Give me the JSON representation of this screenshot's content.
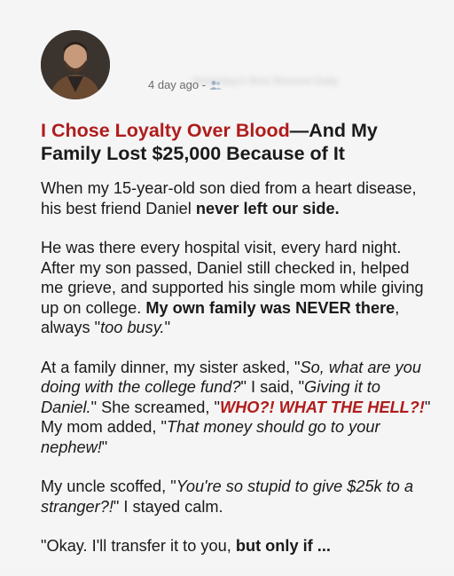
{
  "post": {
    "author_name": "Yesterday's Best Moment Daily",
    "time_ago": "4 day ago -",
    "audience_icon": "friends-icon",
    "title_accent": "I Chose Loyalty Over Blood",
    "title_rest": "—And My Family Lost $25,000 Because of It",
    "p1_a": "When my 15-year-old son died from a heart disease, his best friend Daniel ",
    "p1_b": "never left our side.",
    "p2_a": "He was there every hospital visit, every hard night. After my son passed, Daniel still checked in, helped me grieve, and supported his single mom while giving up on college. ",
    "p2_b": "My own family was NEVER there",
    "p2_c": ", always \"",
    "p2_d": "too busy.",
    "p2_e": "\"",
    "p3_a": "At a family dinner, my sister asked, \"",
    "p3_b": "So, what are you doing with the college fund?",
    "p3_c": "\" I said, \"",
    "p3_d": "Giving it to Daniel.",
    "p3_e": "\" She screamed, \"",
    "p3_f": "WHO?! WHAT THE HELL?!",
    "p3_g": "\" My mom added, \"",
    "p3_h": "That money should go to your nephew!",
    "p3_i": "\"",
    "p4_a": "My uncle scoffed, \"",
    "p4_b": "You're so stupid to give $25k to a stranger?!",
    "p4_c": "\" I stayed calm.",
    "p5_a": "\"Okay. I'll transfer it to you, ",
    "p5_b": "but only if ..."
  },
  "colors": {
    "accent": "#b01c1c",
    "text": "#1a1a1a",
    "meta": "#6b6b6b",
    "background": "#f5f5f5"
  }
}
